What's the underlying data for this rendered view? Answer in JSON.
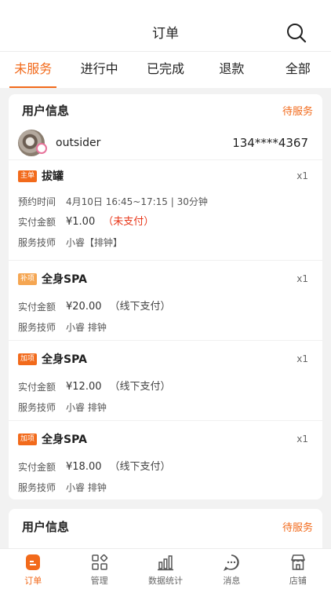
{
  "header": {
    "title": "订单"
  },
  "tabs": [
    {
      "label": "未服务",
      "active": true
    },
    {
      "label": "进行中",
      "active": false
    },
    {
      "label": "已完成",
      "active": false
    },
    {
      "label": "退款",
      "active": false
    },
    {
      "label": "全部",
      "active": false
    }
  ],
  "order": {
    "header_title": "用户信息",
    "status": "待服务",
    "user_name": "outsider",
    "phone": "134****4367",
    "items": [
      {
        "badge": "主单",
        "name": "拔罐",
        "qty": "x1",
        "time_label": "预约时间",
        "time_value": "4月10日 16:45~17:15 | 30分钟",
        "amount_label": "实付金额",
        "amount": "¥1.00",
        "payment_note": "（未支付）",
        "tech_label": "服务技师",
        "tech_value": "小睿【排钟】"
      },
      {
        "badge": "补项",
        "name": "全身SPA",
        "qty": "x1",
        "amount_label": "实付金额",
        "amount": "¥20.00",
        "payment_note": "（线下支付）",
        "tech_label": "服务技师",
        "tech_value": "小睿 排钟"
      },
      {
        "badge": "加项",
        "name": "全身SPA",
        "qty": "x1",
        "amount_label": "实付金额",
        "amount": "¥12.00",
        "payment_note": "（线下支付）",
        "tech_label": "服务技师",
        "tech_value": "小睿 排钟"
      },
      {
        "badge": "加项",
        "name": "全身SPA",
        "qty": "x1",
        "amount_label": "实付金额",
        "amount": "¥18.00",
        "payment_note": "（线下支付）",
        "tech_label": "服务技师",
        "tech_value": "小睿 排钟"
      }
    ]
  },
  "order2": {
    "header_title": "用户信息",
    "status": "待服务"
  },
  "nav": [
    {
      "label": "订单",
      "icon": "order-icon",
      "active": true
    },
    {
      "label": "管理",
      "icon": "grid-icon",
      "active": false
    },
    {
      "label": "数据统计",
      "icon": "chart-icon",
      "active": false
    },
    {
      "label": "消息",
      "icon": "chat-icon",
      "active": false
    },
    {
      "label": "店铺",
      "icon": "store-icon",
      "active": false
    }
  ],
  "colors": {
    "accent": "#f26a1b",
    "unpaid": "#e8381b",
    "badge_light": "#f5a652"
  }
}
